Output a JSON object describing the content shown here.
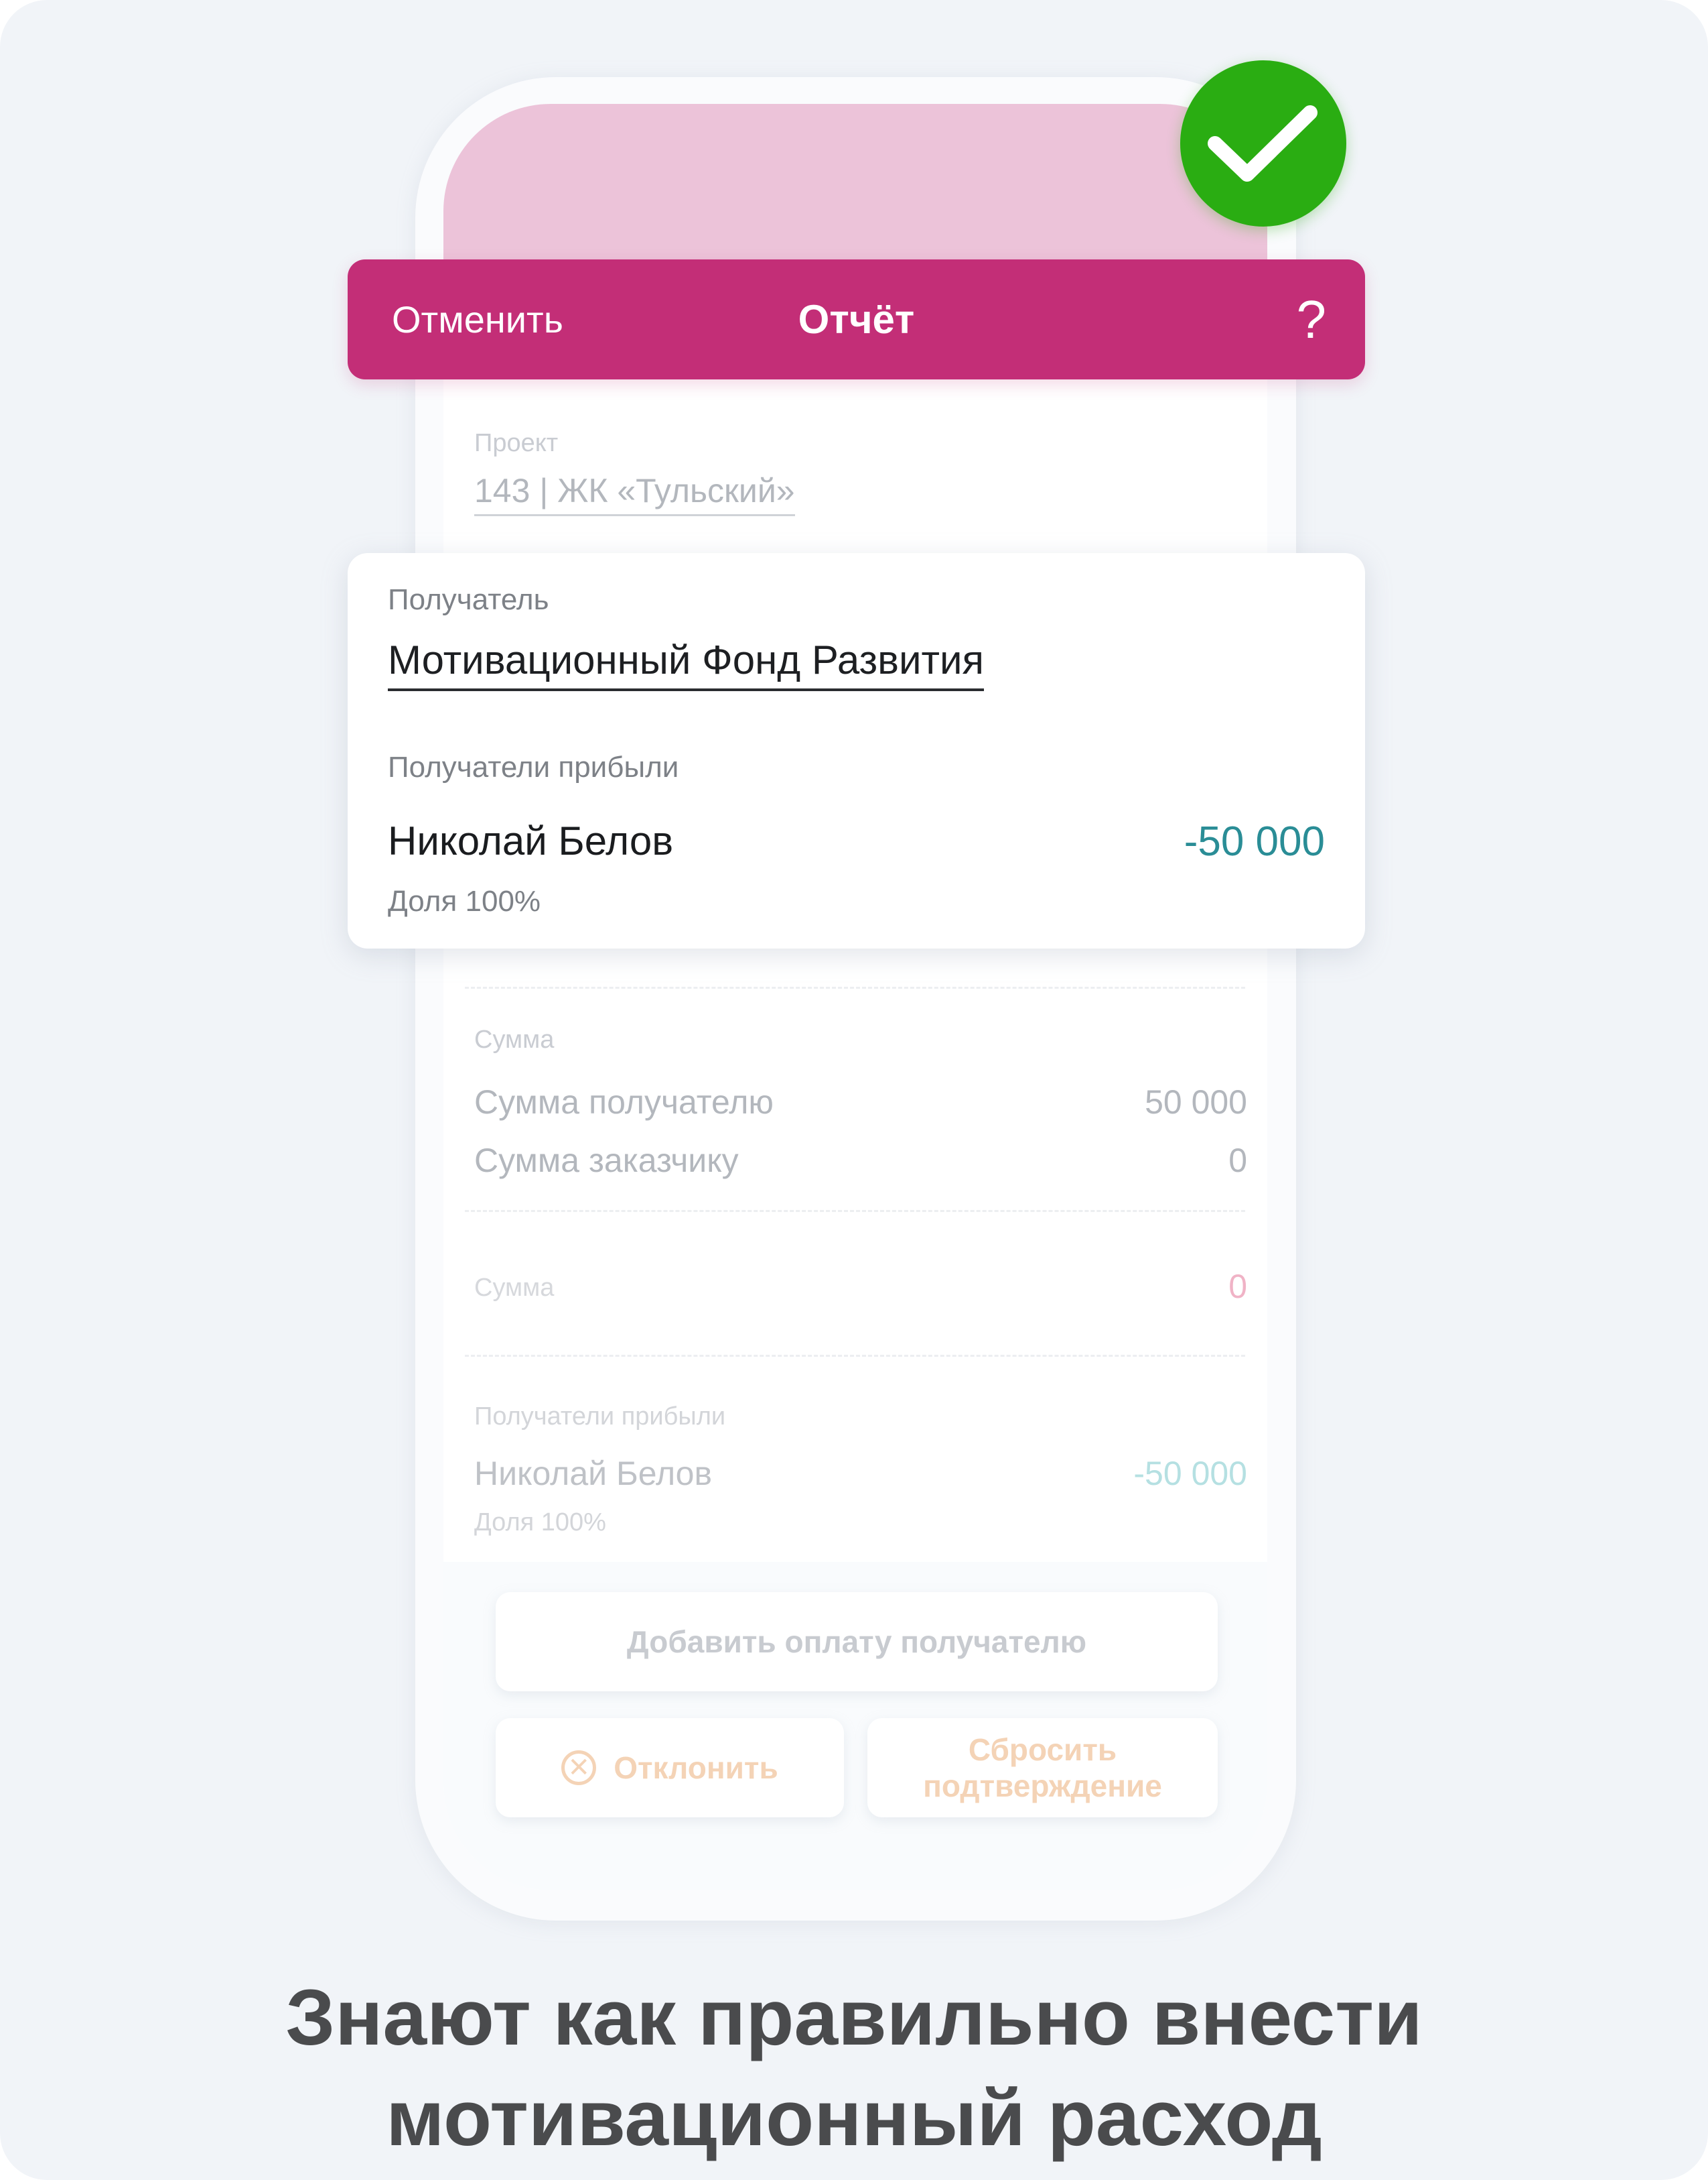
{
  "topbar": {
    "cancel_label": "Отменить",
    "title": "Отчёт",
    "help_label": "?"
  },
  "project": {
    "label": "Проект",
    "value": "143 | ЖК «Тульский»"
  },
  "card": {
    "recipient_label": "Получатель",
    "recipient_value": "Мотивационный Фонд Развития",
    "beneficiaries_label": "Получатели прибыли",
    "beneficiary_name": "Николай Белов",
    "beneficiary_amount": "-50 000",
    "beneficiary_share": "Доля 100%"
  },
  "sums": {
    "label": "Сумма",
    "rows": [
      {
        "label": "Сумма получателю",
        "value": "50 000"
      },
      {
        "label": "Сумма заказчику",
        "value": "0"
      }
    ]
  },
  "total": {
    "label": "Сумма",
    "value": "0"
  },
  "beneficiaries_section": {
    "label": "Получатели прибыли",
    "name": "Николай Белов",
    "amount": "-50 000",
    "share": "Доля 100%"
  },
  "buttons": {
    "add_payment": "Добавить оплату получателю",
    "reject": "Отклонить",
    "reset_line1": "Сбросить",
    "reset_line2": "подтверждение"
  },
  "icons": {
    "success": "check-icon",
    "reject": "close-circle-icon"
  },
  "caption": {
    "line1": "Знают как правильно внести",
    "line2": "мотивационный расход"
  },
  "colors": {
    "brand": "#c32e77",
    "header_pink": "#ecc3d9",
    "success_green": "#2aad12",
    "amount_teal": "#2a8d96",
    "background": "#f1f4f8"
  }
}
